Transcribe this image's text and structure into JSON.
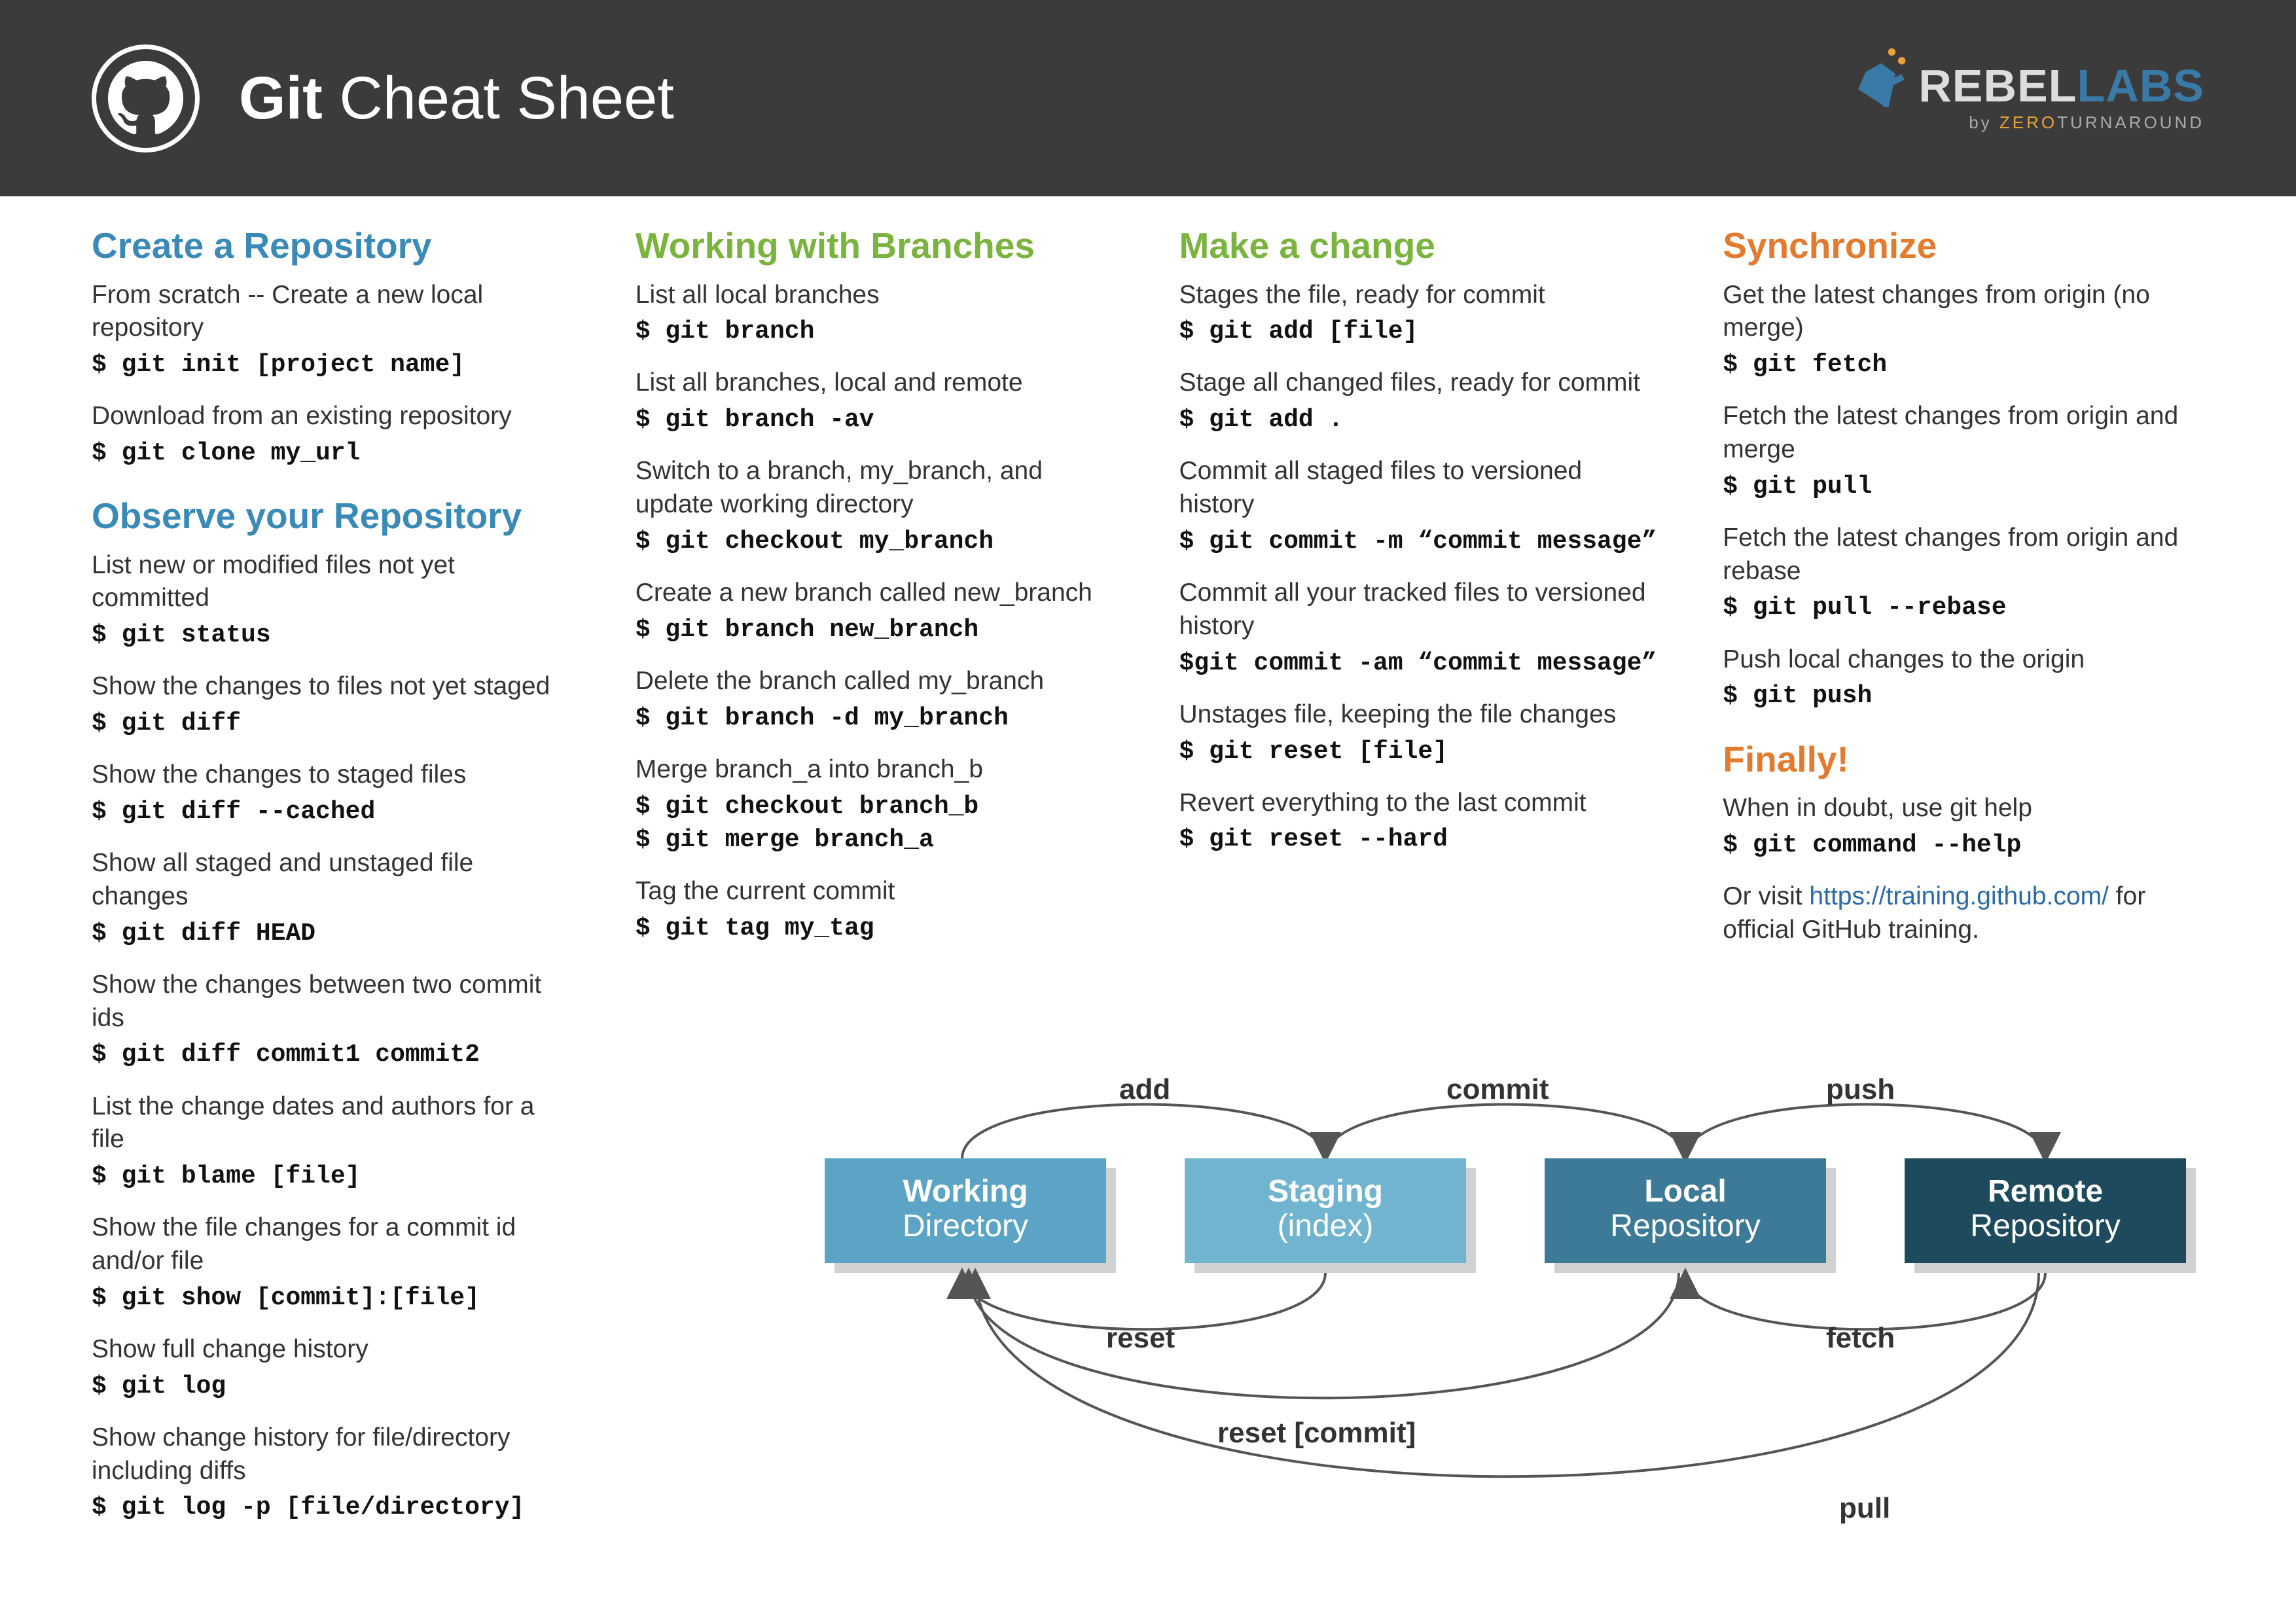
{
  "header": {
    "title_bold": "Git",
    "title_rest": " Cheat Sheet",
    "brand1": "REBEL",
    "brand2": "LABS",
    "brand_by": "by ",
    "brand_zero": "ZERO",
    "brand_turn": "TURNAROUND"
  },
  "sections": {
    "create": {
      "heading": "Create a Repository",
      "i1_desc": "From scratch -- Create a new local repository",
      "i1_cmd": "$ git init [project name]",
      "i2_desc": "Download from an existing repository",
      "i2_cmd": "$ git clone my_url"
    },
    "observe": {
      "heading": "Observe your Repository",
      "i1_desc": "List new or modified files not yet committed",
      "i1_cmd": "$ git status",
      "i2_desc": "Show the changes to files not yet staged",
      "i2_cmd": "$ git diff",
      "i3_desc": "Show the changes to staged files",
      "i3_cmd": "$ git diff --cached",
      "i4_desc": "Show all staged and unstaged file changes",
      "i4_cmd": "$ git diff HEAD",
      "i5_desc": "Show the changes between two commit ids",
      "i5_cmd": "$ git diff commit1 commit2",
      "i6_desc": "List the change dates and authors for a file",
      "i6_cmd": "$ git blame [file]",
      "i7_desc": "Show the file changes for a commit id and/or file",
      "i7_cmd": "$ git show [commit]:[file]",
      "i8_desc": "Show full change history",
      "i8_cmd": "$ git log",
      "i9_desc": "Show change history for file/directory including diffs",
      "i9_cmd": "$ git log -p [file/directory]"
    },
    "branches": {
      "heading": "Working with Branches",
      "i1_desc": "List all local branches",
      "i1_cmd": "$ git branch",
      "i2_desc": "List all branches, local and remote",
      "i2_cmd": "$ git branch -av",
      "i3_desc": "Switch to a branch, my_branch, and update working directory",
      "i3_cmd": "$ git checkout my_branch",
      "i4_desc": "Create a new branch called new_branch",
      "i4_cmd": "$ git branch new_branch",
      "i5_desc": "Delete the branch called my_branch",
      "i5_cmd": "$ git branch -d my_branch",
      "i6_desc": "Merge branch_a into branch_b",
      "i6_cmd": "$ git checkout branch_b\n$ git merge branch_a",
      "i7_desc": "Tag the current commit",
      "i7_cmd": "$ git tag my_tag"
    },
    "change": {
      "heading": "Make a change",
      "i1_desc": "Stages the file, ready for commit",
      "i1_cmd": "$ git add [file]",
      "i2_desc": "Stage all changed files, ready for commit",
      "i2_cmd": "$ git add .",
      "i3_desc": "Commit all staged files to versioned history",
      "i3_cmd": "$ git commit -m “commit message”",
      "i4_desc": "Commit all your tracked files to versioned history",
      "i4_cmd": "$git commit -am “commit message”",
      "i5_desc": "Unstages file, keeping the file changes",
      "i5_cmd": "$ git reset [file]",
      "i6_desc": "Revert everything to the last commit",
      "i6_cmd": "$ git reset --hard"
    },
    "sync": {
      "heading": "Synchronize",
      "i1_desc": "Get the latest changes from origin (no merge)",
      "i1_cmd": "$ git fetch",
      "i2_desc": "Fetch the latest changes from origin and merge",
      "i2_cmd": "$ git pull",
      "i3_desc": "Fetch the latest changes from origin and rebase",
      "i3_cmd": "$ git pull --rebase",
      "i4_desc": "Push local changes to the origin",
      "i4_cmd": "$ git push"
    },
    "finally": {
      "heading": "Finally!",
      "i1_desc": "When in doubt, use git help",
      "i1_cmd": "$ git command --help",
      "visit_pre": "Or visit ",
      "visit_link": "https://training.github.com/",
      "visit_post": " for official GitHub training."
    }
  },
  "diagram": {
    "box1_t1": "Working",
    "box1_t2": "Directory",
    "box2_t1": "Staging",
    "box2_t2": "(index)",
    "box3_t1": "Local",
    "box3_t2": "Repository",
    "box4_t1": "Remote",
    "box4_t2": "Repository",
    "l_add": "add",
    "l_commit": "commit",
    "l_push": "push",
    "l_reset": "reset",
    "l_fetch": "fetch",
    "l_reset_commit": "reset [commit]",
    "l_pull": "pull"
  }
}
